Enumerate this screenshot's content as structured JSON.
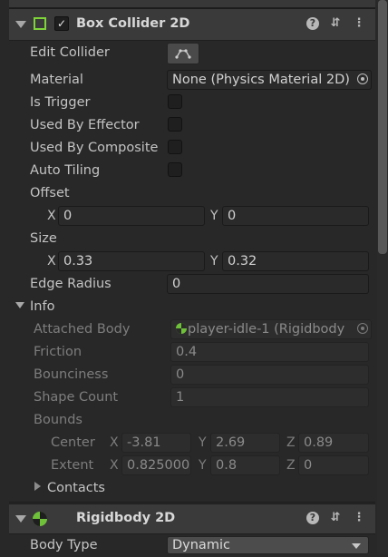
{
  "box_collider": {
    "title": "Box Collider 2D",
    "icons": [
      "help-icon",
      "preset-icon",
      "more-icon"
    ],
    "edit_collider_label": "Edit Collider",
    "material_label": "Material",
    "material_value": "None (Physics Material 2D)",
    "is_trigger_label": "Is Trigger",
    "used_by_effector_label": "Used By Effector",
    "used_by_composite_label": "Used By Composite",
    "auto_tiling_label": "Auto Tiling",
    "offset_label": "Offset",
    "offset_x_label": "X",
    "offset_x": "0",
    "offset_y_label": "Y",
    "offset_y": "0",
    "size_label": "Size",
    "size_x_label": "X",
    "size_x": "0.33",
    "size_y_label": "Y",
    "size_y": "0.32",
    "edge_radius_label": "Edge Radius",
    "edge_radius": "0",
    "info": {
      "label": "Info",
      "attached_body_label": "Attached Body",
      "attached_body_value": "player-idle-1 (Rigidbody",
      "friction_label": "Friction",
      "friction": "0.4",
      "bounciness_label": "Bounciness",
      "bounciness": "0",
      "shape_count_label": "Shape Count",
      "shape_count": "1",
      "bounds_label": "Bounds",
      "center_label": "Center",
      "center_x_label": "X",
      "center_x": "-3.81",
      "center_y_label": "Y",
      "center_y": "2.69",
      "center_z_label": "Z",
      "center_z": "0.89",
      "extent_label": "Extent",
      "extent_x_label": "X",
      "extent_x": "0.825000",
      "extent_y_label": "Y",
      "extent_y": "0.8",
      "extent_z_label": "Z",
      "extent_z": "0",
      "contacts_label": "Contacts"
    }
  },
  "rigidbody": {
    "title": "Rigidbody 2D",
    "body_type_label": "Body Type",
    "body_type_value": "Dynamic"
  },
  "colors": {
    "collider_icon": "#7fd43a",
    "rigidbody_icon": "#6fc13a"
  }
}
